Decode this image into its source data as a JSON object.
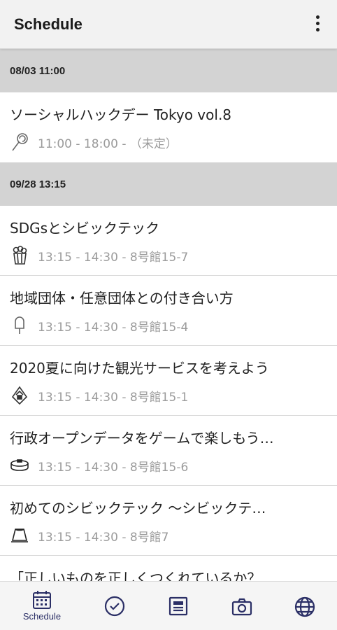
{
  "app_bar": {
    "title": "Schedule",
    "menu_icon": "more-vert-icon"
  },
  "sections": [
    {
      "header": "08/03 11:00",
      "items": [
        {
          "title": "ソーシャルハックデー Tokyo vol.8",
          "meta": "11:00 - 18:00 - （未定）",
          "icon": "lollipop-icon"
        }
      ]
    },
    {
      "header": "09/28 13:15",
      "items": [
        {
          "title": "SDGsとシビックテック",
          "meta": "13:15 - 14:30 - 8号館15-7",
          "icon": "popcorn-icon"
        },
        {
          "title": "地域団体・任意団体との付き合い方",
          "meta": "13:15 - 14:30 - 8号館15-4",
          "icon": "ice-pop-icon"
        },
        {
          "title": "2020夏に向けた観光サービスを考えよう",
          "meta": "13:15 - 14:30 - 8号館15-1",
          "icon": "onigiri-icon"
        },
        {
          "title": "行政オープンデータをゲームで楽しもう…",
          "meta": "13:15 - 14:30 - 8号館15-6",
          "icon": "pancake-icon"
        },
        {
          "title": "初めてのシビックテック 〜シビックテ…",
          "meta": "13:15 - 14:30 - 8号館7",
          "icon": "pudding-icon"
        },
        {
          "title": "「正しいものを正しくつくれているか？…",
          "meta": "",
          "icon": ""
        }
      ]
    }
  ],
  "bottom_nav": {
    "items": [
      {
        "label": "Schedule",
        "icon": "calendar-icon",
        "active": true
      },
      {
        "label": "",
        "icon": "check-circle-icon",
        "active": false
      },
      {
        "label": "",
        "icon": "news-icon",
        "active": false
      },
      {
        "label": "",
        "icon": "camera-icon",
        "active": false
      },
      {
        "label": "",
        "icon": "globe-icon",
        "active": false
      }
    ]
  },
  "colors": {
    "header_band": "#d3d3d3",
    "meta_text": "#9b9b9b",
    "nav_icon": "#2b2f66"
  }
}
